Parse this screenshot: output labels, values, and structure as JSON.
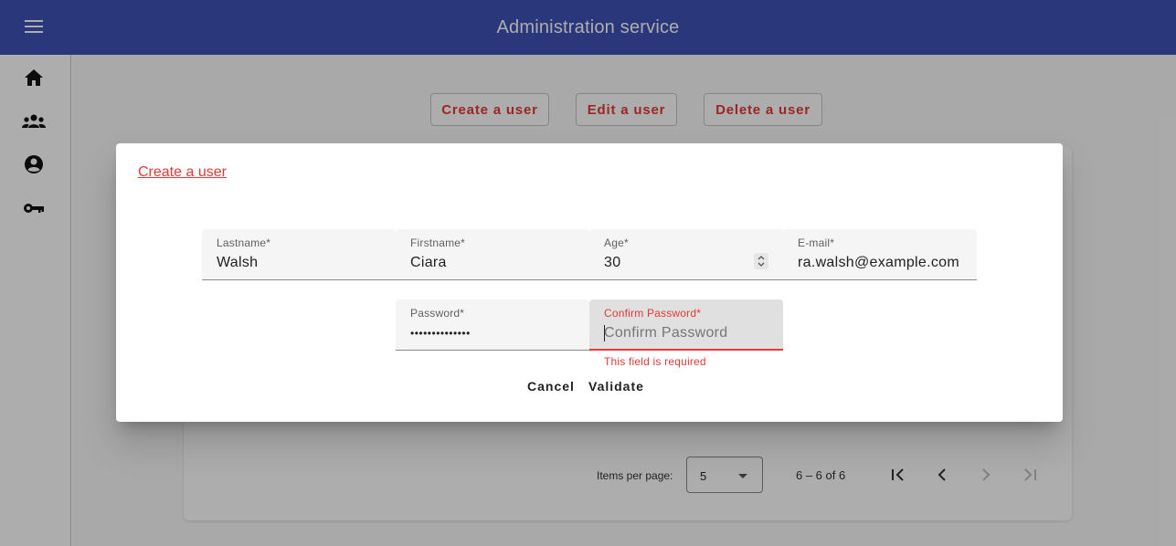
{
  "header": {
    "title": "Administration service",
    "menu_icon": "menu-icon"
  },
  "sidebar": {
    "items": [
      {
        "icon": "home-icon"
      },
      {
        "icon": "groups-icon"
      },
      {
        "icon": "account-circle-icon"
      },
      {
        "icon": "key-icon"
      }
    ]
  },
  "actions": {
    "create_label": "Create a user",
    "edit_label": "Edit a user",
    "delete_label": "Delete a user"
  },
  "paginator": {
    "items_per_page_label": "Items per page:",
    "page_size": "5",
    "range_label": "6 – 6 of 6"
  },
  "dialog": {
    "title": "Create a user",
    "fields": {
      "lastname": {
        "label": "Lastname*",
        "value": "Walsh"
      },
      "firstname": {
        "label": "Firstname*",
        "value": "Ciara"
      },
      "age": {
        "label": "Age*",
        "value": "30"
      },
      "email": {
        "label": "E-mail*",
        "value": "ra.walsh@example.com"
      },
      "password": {
        "label": "Password*",
        "value": "••••••••••••••"
      },
      "confirm_password": {
        "label": "Confirm Password*",
        "placeholder": "Confirm Password",
        "error": "This field is required"
      }
    },
    "cancel_label": "Cancel",
    "validate_label": "Validate"
  },
  "colors": {
    "primary": "#3f51b5",
    "accent": "#e53935",
    "overlay": "rgba(0,0,0,0.32)"
  }
}
